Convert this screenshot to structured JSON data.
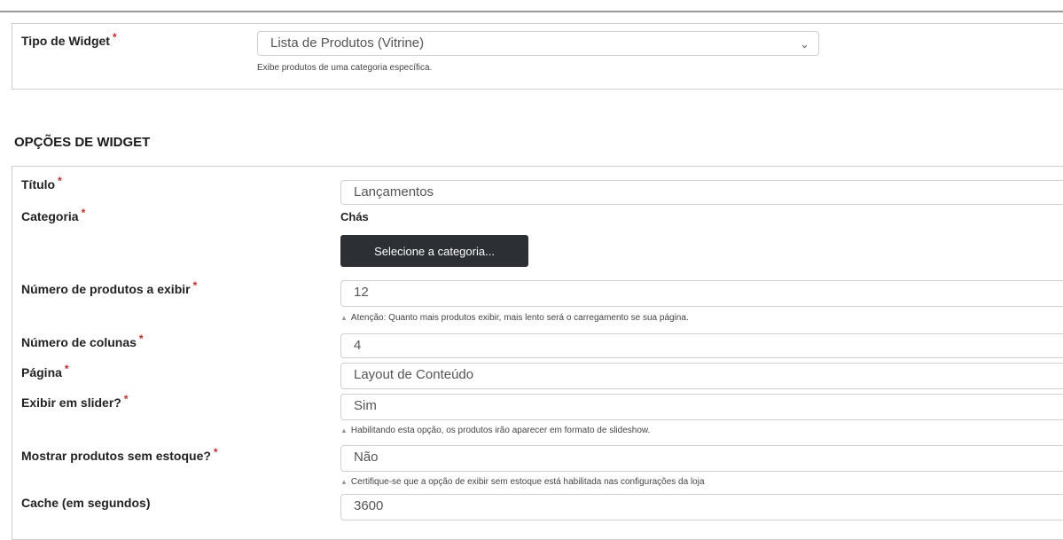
{
  "widget_type": {
    "label": "Tipo de Widget",
    "required": "*",
    "selected": "Lista de Produtos (Vitrine)",
    "hint": "Exibe produtos de uma categoria específica."
  },
  "section_title": "OPÇÕES DE WIDGET",
  "fields": {
    "titulo": {
      "label": "Título",
      "required": "*",
      "value": "Lançamentos"
    },
    "categoria": {
      "label": "Categoria",
      "required": "*",
      "value": "Chás",
      "button": "Selecione a categoria..."
    },
    "num_produtos": {
      "label": "Número de produtos a exibir",
      "required": "*",
      "value": "12",
      "hint": "Atenção: Quanto mais produtos exibir, mais lento será o carregamento se sua página."
    },
    "num_colunas": {
      "label": "Número de colunas",
      "required": "*",
      "value": "4"
    },
    "pagina": {
      "label": "Página",
      "required": "*",
      "value": "Layout de Conteúdo"
    },
    "slider": {
      "label": "Exibir em slider?",
      "required": "*",
      "value": "Sim",
      "hint": "Habilitando esta opção, os produtos irão aparecer em formato de slideshow."
    },
    "sem_estoque": {
      "label": "Mostrar produtos sem estoque?",
      "required": "*",
      "value": "Não",
      "hint": "Certifique-se que a opção de exibir sem estoque está habilitada nas configurações da loja"
    },
    "cache": {
      "label": "Cache (em segundos)",
      "value": "3600"
    }
  },
  "icons": {
    "chevron": "chevron-down-icon",
    "hint_marker": "triangle-up-icon"
  }
}
